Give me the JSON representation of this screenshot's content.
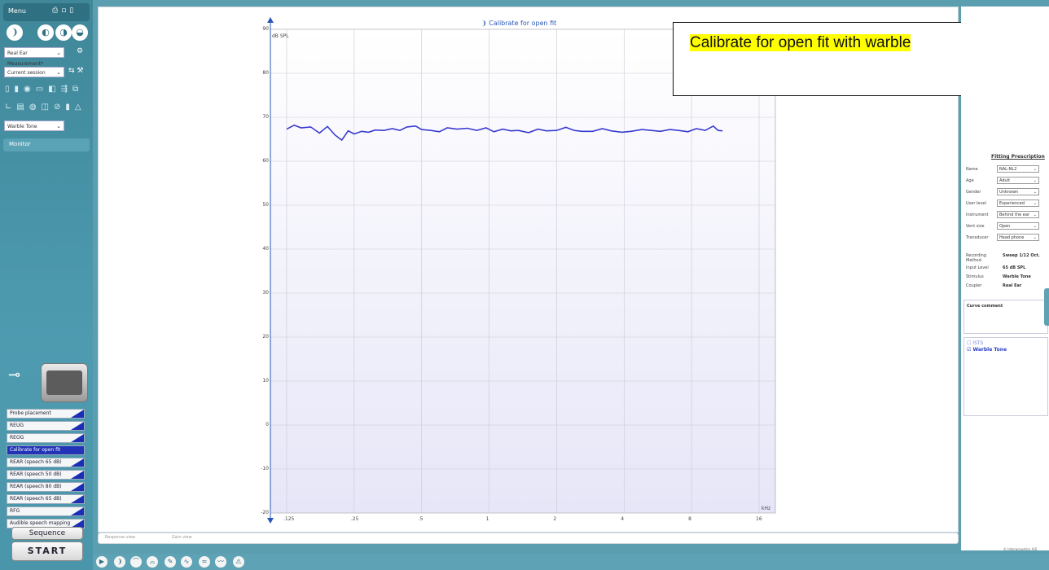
{
  "sidebar": {
    "menu_label": "Menu",
    "measurement_select": "Real Ear Measurement*",
    "session_select": "Current session",
    "stimulus_select": "Warble Tone",
    "monitor_label": "Monitor",
    "tests": [
      {
        "label": "Probe placement",
        "active": false
      },
      {
        "label": "REUG",
        "active": false
      },
      {
        "label": "REOG",
        "active": false
      },
      {
        "label": "Calibrate for open fit",
        "active": true
      },
      {
        "label": "REAR (speech 65 dB)",
        "active": false
      },
      {
        "label": "REAR (speech 50 dB)",
        "active": false
      },
      {
        "label": "REAR (speech 80 dB)",
        "active": false
      },
      {
        "label": "REAR (speech 65 dB)",
        "active": false
      },
      {
        "label": "RFG",
        "active": false
      },
      {
        "label": "Audible speech mapping",
        "active": false
      }
    ],
    "sequence_label": "Sequence",
    "start_label": "START"
  },
  "chart_data": {
    "type": "line",
    "title": "Calibrate for open fit",
    "ylabel": "dB SPL",
    "xlabel": "kHz",
    "y_ticks": [
      90,
      80,
      70,
      60,
      50,
      40,
      30,
      20,
      10,
      0,
      -10,
      -20
    ],
    "x_ticks": [
      ".125",
      ".25",
      ".5",
      "1",
      "2",
      "4",
      "8",
      "16"
    ],
    "xlim": [
      0.125,
      16
    ],
    "ylim": [
      -20,
      90
    ],
    "log_x": true,
    "grid": true,
    "series": [
      {
        "color": "#3a3ad0",
        "x": [
          0.125,
          0.135,
          0.145,
          0.16,
          0.175,
          0.19,
          0.205,
          0.22,
          0.235,
          0.25,
          0.27,
          0.29,
          0.31,
          0.34,
          0.37,
          0.4,
          0.43,
          0.47,
          0.5,
          0.55,
          0.6,
          0.65,
          0.72,
          0.8,
          0.88,
          0.97,
          1.05,
          1.15,
          1.25,
          1.35,
          1.5,
          1.65,
          1.8,
          2.0,
          2.2,
          2.4,
          2.6,
          2.9,
          3.2,
          3.5,
          3.9,
          4.3,
          4.8,
          5.3,
          5.8,
          6.4,
          7.0,
          7.7,
          8.4,
          9.2,
          10.0,
          10.5,
          11.0
        ],
        "y": [
          67.3,
          68.2,
          67.6,
          67.8,
          66.4,
          67.9,
          66.0,
          64.8,
          66.9,
          66.2,
          66.8,
          66.6,
          67.1,
          67.0,
          67.4,
          67.0,
          67.8,
          68.0,
          67.2,
          67.0,
          66.7,
          67.6,
          67.3,
          67.5,
          67.0,
          67.6,
          66.7,
          67.3,
          66.9,
          67.0,
          66.5,
          67.3,
          66.9,
          67.0,
          67.7,
          67.0,
          66.8,
          66.8,
          67.4,
          66.9,
          66.6,
          66.8,
          67.2,
          67.0,
          66.8,
          67.2,
          67.0,
          66.7,
          67.4,
          67.0,
          68.0,
          67.0,
          66.9
        ]
      }
    ]
  },
  "tooltip": {
    "text": "Calibrate for open fit with warble"
  },
  "bottom_strip": {
    "left": "Response view",
    "right": "Gain view"
  },
  "fitting_prescription": {
    "title": "Fitting Prescription",
    "rows": [
      {
        "label": "Name",
        "value": "NAL-NL2"
      },
      {
        "label": "Age",
        "value": "Adult"
      },
      {
        "label": "Gender",
        "value": "Unknown"
      },
      {
        "label": "User level",
        "value": "Experienced"
      },
      {
        "label": "Instrument",
        "value": "Behind the ear"
      },
      {
        "label": "Vent size",
        "value": "Open"
      },
      {
        "label": "Transducer",
        "value": "Head phone"
      }
    ]
  },
  "info": [
    {
      "label": "Recording Method",
      "value": "Sweep 1/12 Oct."
    },
    {
      "label": "Input Level",
      "value": "65 dB SPL"
    },
    {
      "label": "Stimulus",
      "value": "Warble Tone"
    },
    {
      "label": "Coupler",
      "value": "Real Ear"
    }
  ],
  "curve_comment_label": "Curve comment",
  "legend": {
    "item1": "ISTS",
    "item2": "Warble Tone"
  },
  "copyright": "© Interacoustics A/S"
}
